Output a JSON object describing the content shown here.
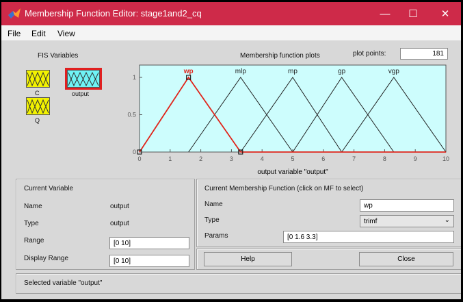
{
  "window": {
    "title": "Membership Function Editor: stage1and2_cq",
    "minimize": "—",
    "maximize": "☐",
    "close": "✕",
    "titlebar_color": "#ce2a49"
  },
  "menu": [
    "File",
    "Edit",
    "View"
  ],
  "fis": {
    "heading": "FIS Variables",
    "vars": [
      {
        "label": "C"
      },
      {
        "label": "output"
      },
      {
        "label": "Q"
      }
    ]
  },
  "plot": {
    "heading": "Membership function plots",
    "plot_points_label": "plot points:",
    "plot_points": "181",
    "xlabel": "output variable \"output\"",
    "xticks": [
      "0",
      "1",
      "2",
      "3",
      "4",
      "5",
      "6",
      "7",
      "8",
      "9",
      "10"
    ],
    "yticks": [
      "0",
      "0.5",
      "1"
    ],
    "bg_color": "#cdfdfd",
    "mf": [
      {
        "name": "wp",
        "params": [
          0,
          1.6,
          3.3
        ],
        "selected": true
      },
      {
        "name": "mlp",
        "params": [
          1.6,
          3.3,
          5
        ]
      },
      {
        "name": "mp",
        "params": [
          3.3,
          5,
          6.6
        ]
      },
      {
        "name": "gp",
        "params": [
          5,
          6.6,
          8.3
        ]
      },
      {
        "name": "vgp",
        "params": [
          6.6,
          8.3,
          10
        ]
      }
    ]
  },
  "current_variable": {
    "heading": "Current Variable",
    "name_label": "Name",
    "name_value": "output",
    "type_label": "Type",
    "type_value": "output",
    "range_label": "Range",
    "range_value": "[0 10]",
    "display_range_label": "Display Range",
    "display_range_value": "[0 10]"
  },
  "current_mf": {
    "heading": "Current Membership Function (click on MF to select)",
    "name_label": "Name",
    "name_value": "wp",
    "type_label": "Type",
    "type_value": "trimf",
    "params_label": "Params",
    "params_value": "[0 1.6 3.3]"
  },
  "buttons": {
    "help": "Help",
    "close": "Close"
  },
  "status": "Selected variable \"output\""
}
